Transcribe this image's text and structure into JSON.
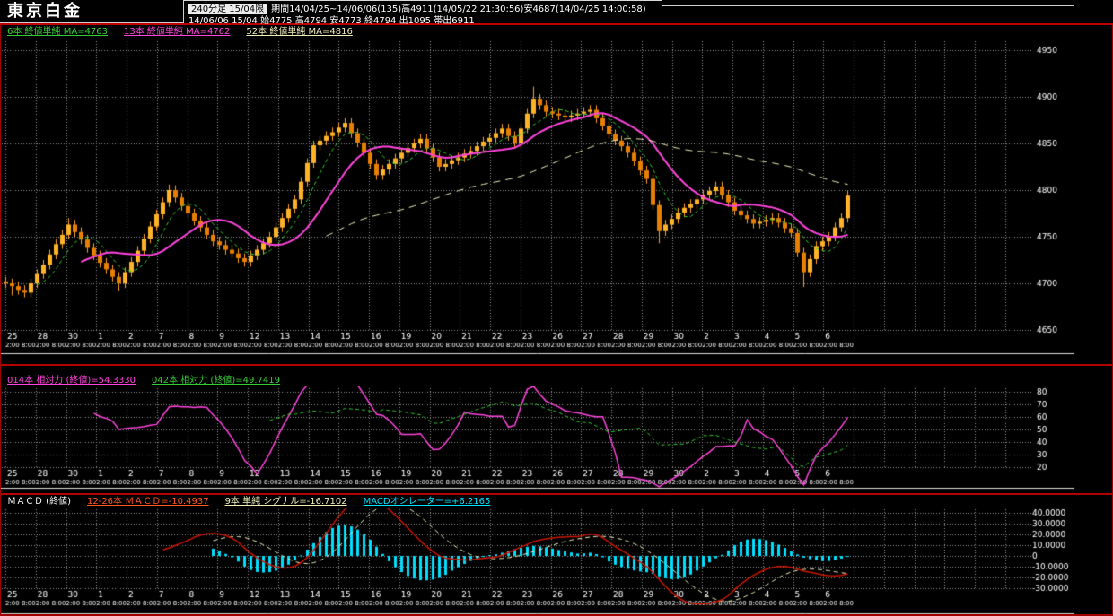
{
  "header": {
    "title": "東京白金",
    "mode_button": "240分足 15/04限",
    "period_info": "期間14/04/25~14/06/06(135)高4911(14/05/22 21:30:56)安4687(14/04/25 14:00:58)",
    "quote_line": "14/06/06 15/04 始4775 高4794 安4773 終4794 出1095 帯出6911"
  },
  "main_panel": {
    "legend": [
      {
        "label": "6本 終値単純 MA=4763",
        "color": "#33cc33"
      },
      {
        "label": "13本 終値単純 MA=4762",
        "color": "#ff44dd"
      },
      {
        "label": "52本 終値単純 MA=4816",
        "color": "#eeeebb"
      }
    ],
    "y_ticks": [
      4950,
      4900,
      4850,
      4800,
      4750,
      4700,
      4650
    ],
    "y_tick_labels": [
      "4950",
      "4900",
      "4850",
      "4800",
      "4750",
      "4700",
      "4650"
    ]
  },
  "rsi_panel": {
    "legend": [
      {
        "label": "014本 相対力 (終値)=54.3330",
        "color": "#ff44dd"
      },
      {
        "label": "042本 相対力 (終値)=49.7419",
        "color": "#33cc33"
      }
    ],
    "y_ticks": [
      80,
      70,
      60,
      50,
      40,
      30,
      20
    ],
    "y_tick_labels": [
      "80",
      "70",
      "60",
      "50",
      "40",
      "30",
      "20"
    ]
  },
  "macd_panel": {
    "legend": [
      {
        "label": "ＭＡＣＤ (終値)",
        "color": "#ffffff"
      },
      {
        "label": "12-26本 ＭＡＣＤ=-10.4937",
        "color": "#ff5522"
      },
      {
        "label": "9本 単純 シグナル=-16.7102",
        "color": "#eeeebb"
      },
      {
        "label": "MACDオシレーター=+6.2165",
        "color": "#00e0ff"
      }
    ],
    "y_ticks": [
      40,
      30,
      20,
      10,
      0,
      -10,
      -20,
      -30
    ],
    "y_tick_labels": [
      "40.0000",
      "30.0000",
      "20.0000",
      "10.0000",
      "0",
      "-10.0000",
      "-20.0000",
      "-30.0000"
    ]
  },
  "x_axis": {
    "day_labels": [
      "25",
      "28",
      "30",
      "1",
      "2",
      "7",
      "8",
      "9",
      "12",
      "13",
      "14",
      "15",
      "16",
      "19",
      "20",
      "21",
      "22",
      "23",
      "26",
      "27",
      "28",
      "29",
      "30",
      "2",
      "3",
      "4",
      "5",
      "6"
    ],
    "time_label": "2:00 8:00"
  },
  "chart_data": [
    {
      "type": "candlestick",
      "title": "東京白金 240分足 15/04限",
      "ylim": [
        4645,
        4975
      ],
      "bars": 135,
      "period_high": {
        "value": 4911,
        "time": "14/05/22 21:30:56"
      },
      "period_low": {
        "value": 4687,
        "time": "14/04/25 14:00:58"
      },
      "last_quote": {
        "open": 4775,
        "high": 4794,
        "low": 4773,
        "close": 4794,
        "volume": 1095
      },
      "close": [
        4700,
        4697,
        4693,
        4690,
        4700,
        4710,
        4720,
        4731,
        4742,
        4752,
        4763,
        4755,
        4747,
        4738,
        4730,
        4722,
        4715,
        4707,
        4700,
        4712,
        4723,
        4735,
        4748,
        4761,
        4774,
        4787,
        4800,
        4792,
        4783,
        4775,
        4767,
        4760,
        4752,
        4745,
        4741,
        4736,
        4732,
        4727,
        4723,
        4730,
        4736,
        4743,
        4750,
        4760,
        4770,
        4780,
        4790,
        4809,
        4829,
        4848,
        4853,
        4858,
        4862,
        4867,
        4872,
        4861,
        4851,
        4840,
        4828,
        4816,
        4822,
        4828,
        4834,
        4840,
        4845,
        4850,
        4855,
        4845,
        4835,
        4825,
        4828,
        4832,
        4835,
        4839,
        4842,
        4847,
        4852,
        4856,
        4861,
        4866,
        4858,
        4850,
        4866,
        4882,
        4898,
        4891,
        4884,
        4882,
        4880,
        4878,
        4880,
        4882,
        4884,
        4886,
        4877,
        4869,
        4860,
        4853,
        4847,
        4840,
        4831,
        4821,
        4812,
        4784,
        4756,
        4763,
        4769,
        4776,
        4781,
        4785,
        4790,
        4795,
        4799,
        4804,
        4795,
        4787,
        4778,
        4773,
        4769,
        4764,
        4766,
        4768,
        4770,
        4765,
        4759,
        4754,
        4733,
        4712,
        4726,
        4740,
        4745,
        4750,
        4760,
        4770,
        4794
      ],
      "wick_highs": {
        "10": 4770,
        "26": 4806,
        "84": 4911
      },
      "wick_lows": {
        "1": 4687,
        "18": 4692,
        "104": 4743,
        "127": 4696
      },
      "overlays": [
        {
          "name": "MA6",
          "period": 6,
          "color": "#33cc33",
          "style": "dashed",
          "last": 4763
        },
        {
          "name": "MA13",
          "period": 13,
          "color": "#ff44dd",
          "style": "solid",
          "last": 4762
        },
        {
          "name": "MA52",
          "period": 52,
          "color": "#eeeebb",
          "style": "dashed",
          "last": 4816
        }
      ]
    },
    {
      "type": "line",
      "title": "相対力 (RSI)",
      "ylim": [
        20,
        80
      ],
      "series": [
        {
          "name": "相対力14本",
          "period": 14,
          "color": "#ff44dd",
          "style": "solid",
          "last": 54.333
        },
        {
          "name": "相対力42本",
          "period": 42,
          "color": "#33cc33",
          "style": "dashed",
          "last": 49.7419
        }
      ]
    },
    {
      "type": "line+bar",
      "title": "MACD",
      "ylim": [
        -30,
        40
      ],
      "series": [
        {
          "name": "MACD 12-26本",
          "color": "#cc1500",
          "style": "solid",
          "last": -10.4937
        },
        {
          "name": "シグナル 9本単純",
          "color": "#eeeebb",
          "style": "dashed",
          "last": -16.7102
        },
        {
          "name": "MACDオシレーター",
          "color": "#00e0ff",
          "style": "bar",
          "last": 6.2165
        }
      ]
    }
  ]
}
